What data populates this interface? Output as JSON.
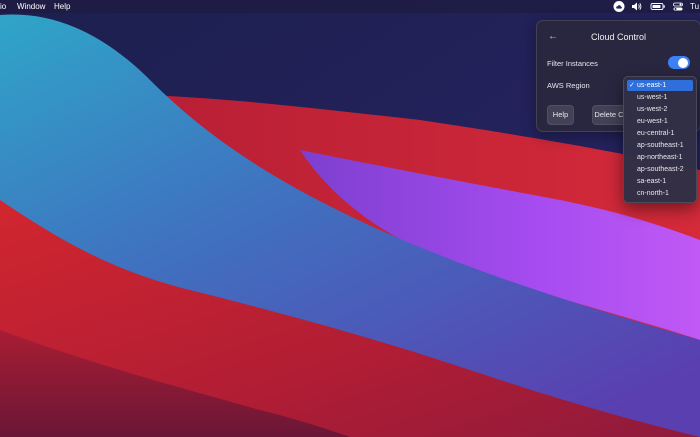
{
  "menubar": {
    "items": [
      "io",
      "Window",
      "Help"
    ],
    "clock": "Tu",
    "icons": [
      "cloud-icon",
      "volume-icon",
      "battery-icon",
      "control-center-icon"
    ]
  },
  "popover": {
    "title": "Cloud Control",
    "filter_label": "Filter Instances",
    "filter_on": true,
    "region_label": "AWS Region",
    "help_label": "Help",
    "delete_label": "Delete C"
  },
  "dropdown": {
    "selected": "us-east-1",
    "options": [
      "us-east-1",
      "us-west-1",
      "us-west-2",
      "eu-west-1",
      "eu-central-1",
      "ap-southeast-1",
      "ap-northeast-1",
      "ap-southeast-2",
      "sa-east-1",
      "cn-north-1"
    ]
  },
  "colors": {
    "accent": "#3b82f6",
    "selection": "#2f6fdb"
  }
}
